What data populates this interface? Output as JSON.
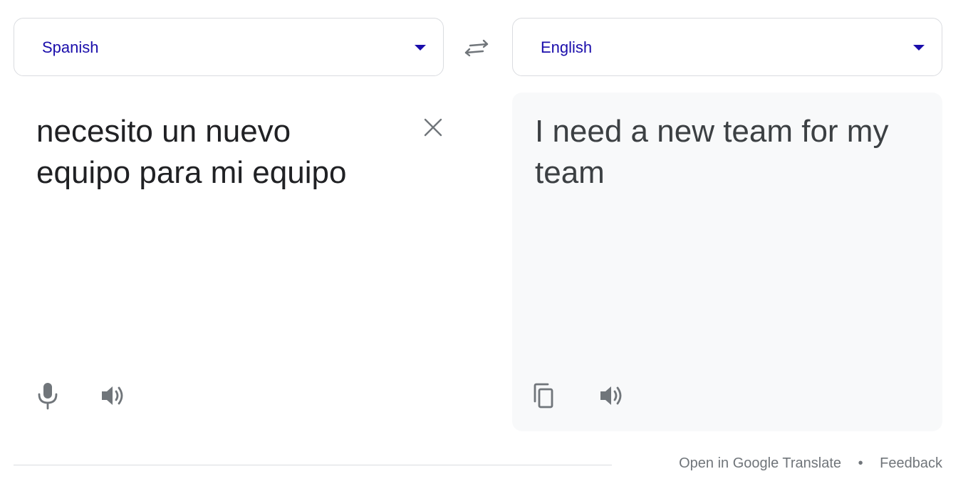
{
  "source_language": {
    "label": "Spanish"
  },
  "target_language": {
    "label": "English"
  },
  "source": {
    "text": "necesito un nuevo equipo para mi equipo"
  },
  "target": {
    "text": "I need a new team for my team"
  },
  "footer": {
    "open_link": "Open in Google Translate",
    "separator": "•",
    "feedback_link": "Feedback"
  },
  "colors": {
    "accent": "#1a0dab",
    "icon": "#70757a",
    "panel_bg": "#f8f9fa",
    "border": "#dadce0"
  },
  "icons": [
    "chevron-down-icon",
    "swap-icon",
    "close-icon",
    "microphone-icon",
    "speaker-icon",
    "copy-icon"
  ]
}
